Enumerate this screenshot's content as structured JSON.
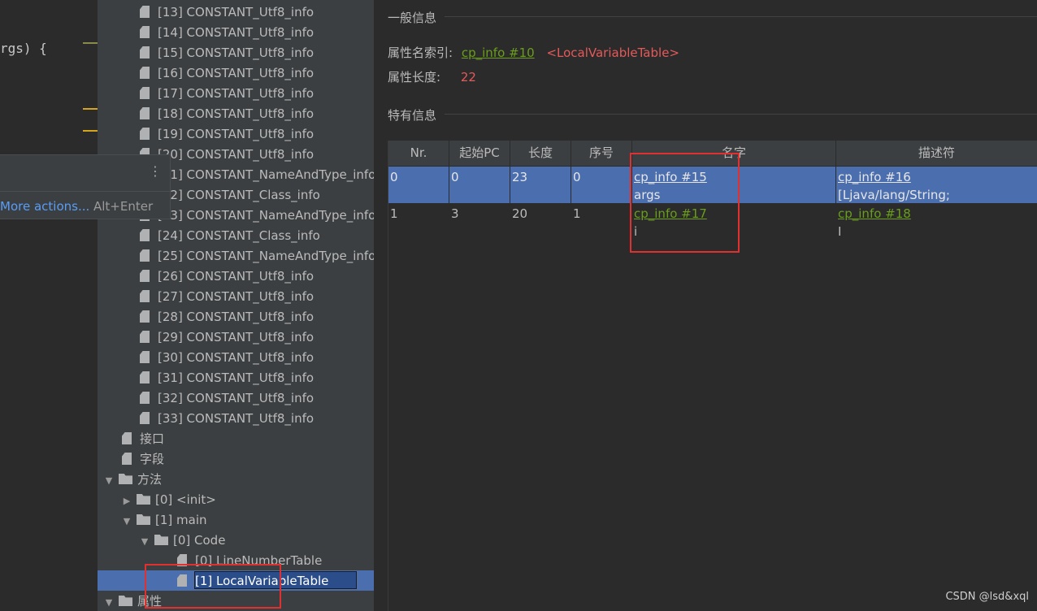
{
  "editor": {
    "code_line": "rgs) {",
    "popup": {
      "more_actions": "More actions...",
      "shortcut": "Alt+Enter",
      "menu_icon": "vertical-dots-icon"
    }
  },
  "tree": {
    "constants": [
      "[13] CONSTANT_Utf8_info",
      "[14] CONSTANT_Utf8_info",
      "[15] CONSTANT_Utf8_info",
      "[16] CONSTANT_Utf8_info",
      "[17] CONSTANT_Utf8_info",
      "[18] CONSTANT_Utf8_info",
      "[19] CONSTANT_Utf8_info",
      "[20] CONSTANT_Utf8_info",
      "[21] CONSTANT_NameAndType_info",
      "[22] CONSTANT_Class_info",
      "[23] CONSTANT_NameAndType_info",
      "[24] CONSTANT_Class_info",
      "[25] CONSTANT_NameAndType_info",
      "[26] CONSTANT_Utf8_info",
      "[27] CONSTANT_Utf8_info",
      "[28] CONSTANT_Utf8_info",
      "[29] CONSTANT_Utf8_info",
      "[30] CONSTANT_Utf8_info",
      "[31] CONSTANT_Utf8_info",
      "[32] CONSTANT_Utf8_info",
      "[33] CONSTANT_Utf8_info"
    ],
    "interfaces": "接口",
    "fields": "字段",
    "methods": "方法",
    "init": "[0] <init>",
    "main": "[1] main",
    "code": "[0] Code",
    "line_number_table": "[0] LineNumberTable",
    "local_variable_table": "[1] LocalVariableTable",
    "attributes": "属性"
  },
  "detail": {
    "general_section": "一般信息",
    "attr_name_index_label": "属性名索引:",
    "attr_name_index_link": "cp_info #10",
    "attr_name_value": "<LocalVariableTable>",
    "attr_length_label": "属性长度:",
    "attr_length_value": "22",
    "specific_section": "特有信息",
    "table": {
      "headers": [
        "Nr.",
        "起始PC",
        "长度",
        "序号",
        "名字",
        "描述符"
      ],
      "rows": [
        {
          "nr": "0",
          "start_pc": "0",
          "length": "23",
          "index": "0",
          "name_link": "cp_info #15",
          "name": "args",
          "desc_link": "cp_info #16",
          "desc": "[Ljava/lang/String;"
        },
        {
          "nr": "1",
          "start_pc": "3",
          "length": "20",
          "index": "1",
          "name_link": "cp_info #17",
          "name": "i",
          "desc_link": "cp_info #18",
          "desc": "I"
        }
      ]
    }
  },
  "watermark": "CSDN @lsd&xql",
  "colors": {
    "selection": "#4b6eaf",
    "link_green": "#6a9e1d",
    "value_red": "#e45a5a",
    "annotation_red": "#e03030"
  }
}
